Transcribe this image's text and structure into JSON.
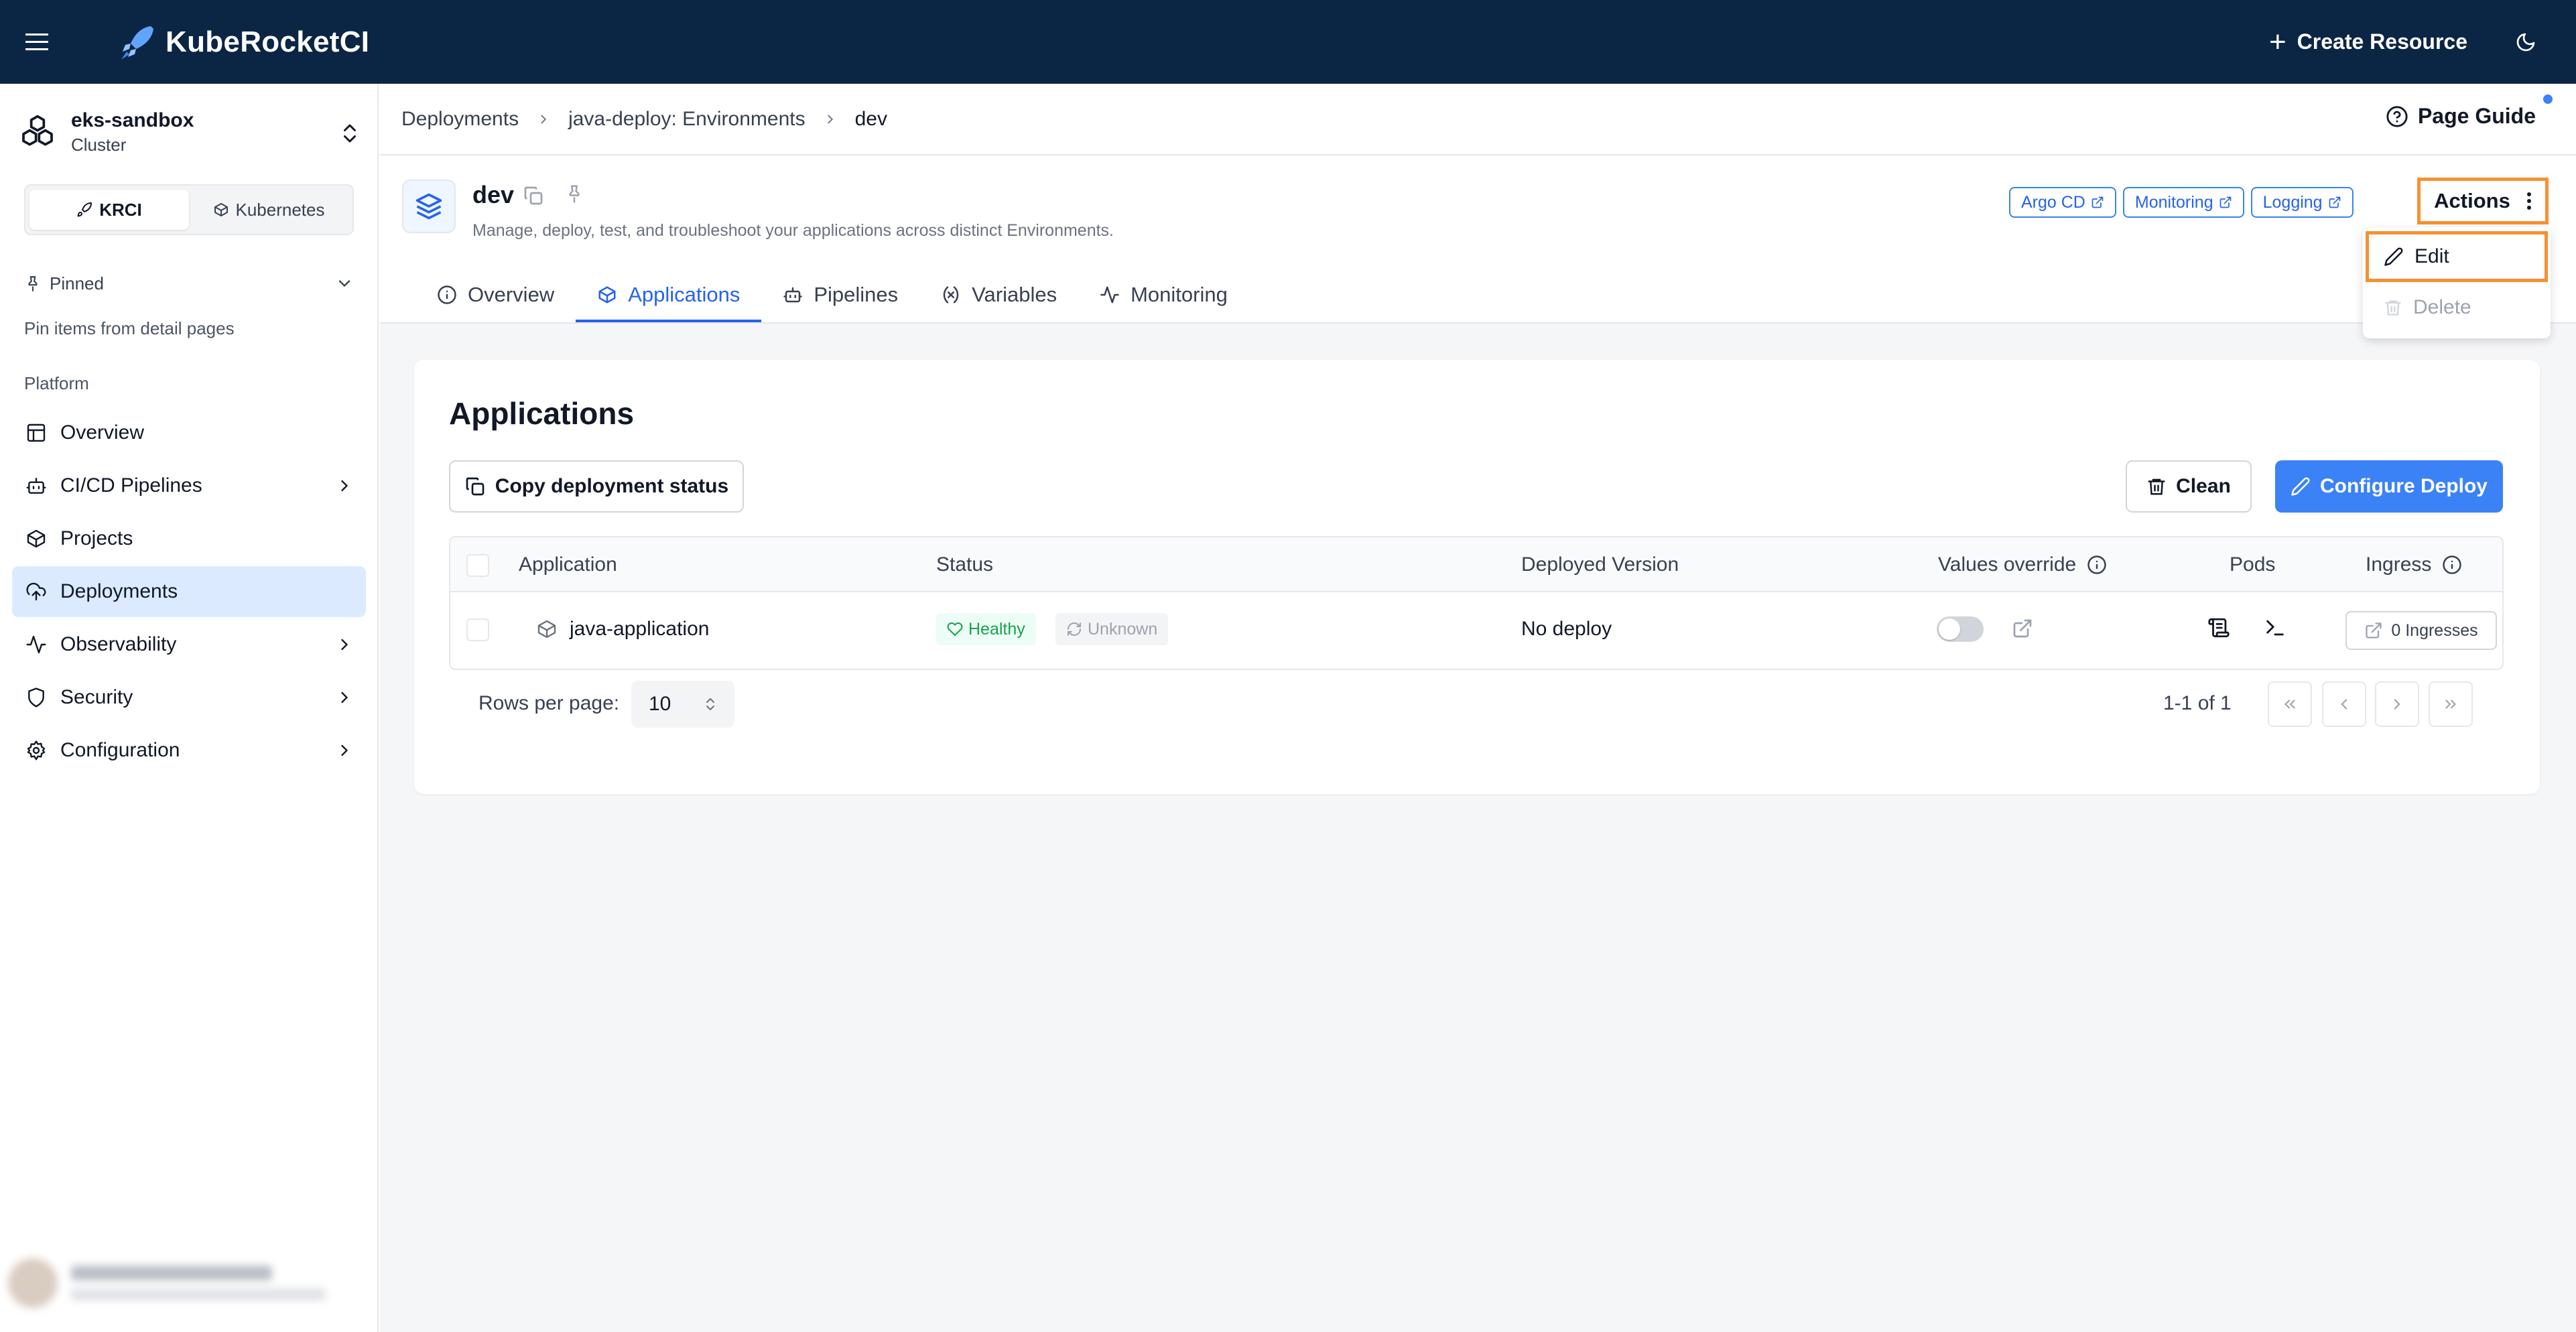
{
  "app": {
    "name": "KubeRocketCI",
    "create_resource_label": "Create Resource"
  },
  "cluster": {
    "name": "eks-sandbox",
    "type": "Cluster"
  },
  "mode_switch": {
    "options": [
      "KRCI",
      "Kubernetes"
    ],
    "active": "KRCI"
  },
  "sidebar": {
    "pinned_label": "Pinned",
    "pinned_note": "Pin items from detail pages",
    "section_label": "Platform",
    "items": [
      {
        "label": "Overview",
        "icon": "layout-icon",
        "has_children": false
      },
      {
        "label": "CI/CD Pipelines",
        "icon": "bot-icon",
        "has_children": true
      },
      {
        "label": "Projects",
        "icon": "box-icon",
        "has_children": false
      },
      {
        "label": "Deployments",
        "icon": "cloud-upload-icon",
        "has_children": false,
        "active": true
      },
      {
        "label": "Observability",
        "icon": "activity-icon",
        "has_children": true
      },
      {
        "label": "Security",
        "icon": "shield-icon",
        "has_children": true
      },
      {
        "label": "Configuration",
        "icon": "gear-icon",
        "has_children": true
      }
    ]
  },
  "breadcrumb": [
    "Deployments",
    "java-deploy: Environments",
    "dev"
  ],
  "page_guide_label": "Page Guide",
  "header": {
    "title": "dev",
    "description": "Manage, deploy, test, and troubleshoot your applications across distinct Environments.",
    "external_links": [
      "Argo CD",
      "Monitoring",
      "Logging"
    ],
    "actions_label": "Actions"
  },
  "actions_menu": {
    "edit_label": "Edit",
    "delete_label": "Delete"
  },
  "tabs": [
    {
      "label": "Overview",
      "icon": "info-icon"
    },
    {
      "label": "Applications",
      "icon": "box-icon",
      "active": true
    },
    {
      "label": "Pipelines",
      "icon": "bot-icon"
    },
    {
      "label": "Variables",
      "icon": "variable-icon"
    },
    {
      "label": "Monitoring",
      "icon": "activity-icon"
    }
  ],
  "applications": {
    "title": "Applications",
    "copy_status_label": "Copy deployment status",
    "clean_label": "Clean",
    "configure_label": "Configure Deploy",
    "columns": {
      "application": "Application",
      "status": "Status",
      "deployed_version": "Deployed Version",
      "values_override": "Values override",
      "pods": "Pods",
      "ingress": "Ingress"
    },
    "rows": [
      {
        "application": "java-application",
        "health": "Healthy",
        "sync": "Unknown",
        "deployed_version": "No deploy",
        "values_override": false,
        "ingress": "0 Ingresses"
      }
    ],
    "pagination": {
      "rows_per_page_label": "Rows per page:",
      "rows_per_page": "10",
      "info": "1-1 of 1"
    }
  },
  "colors": {
    "topbar": "#0b2545",
    "accent": "#3b82f6",
    "highlight": "#f59132",
    "healthy": "#16a34a"
  }
}
